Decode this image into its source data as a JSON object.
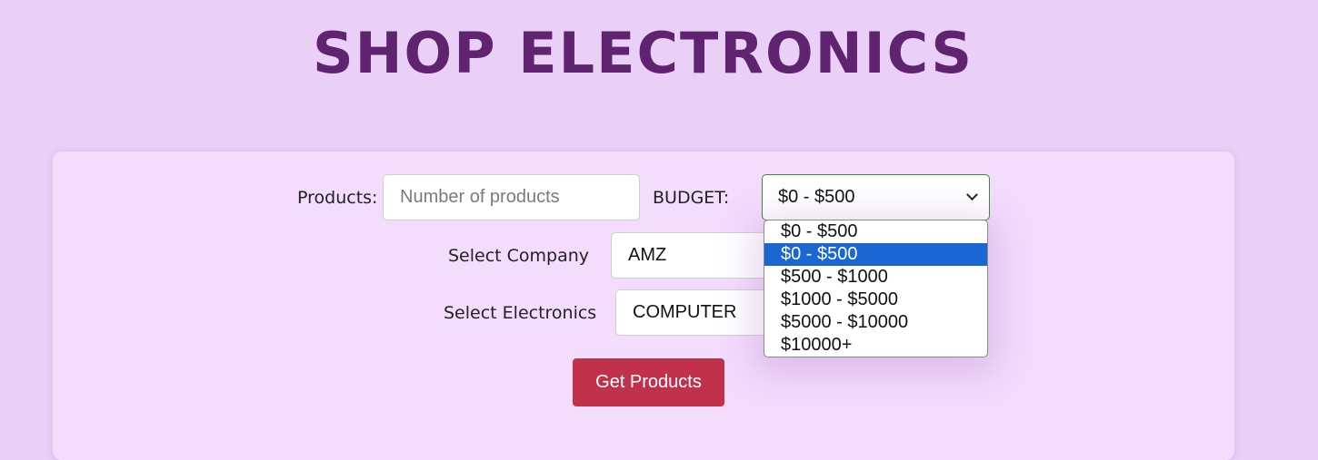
{
  "header": {
    "title": "SHOP ELECTRONICS"
  },
  "form": {
    "products_label": "Products:",
    "products_input": {
      "value": "",
      "placeholder": "Number of products"
    },
    "budget_label": "BUDGET:",
    "budget_select": {
      "selected": "$0 - $500"
    },
    "budget_options": [
      "$0 - $500",
      "$0 - $500",
      "$500 - $1000",
      "$1000 - $5000",
      "$5000 - $10000",
      "$10000+"
    ],
    "budget_highlighted_index": 1,
    "company_label": "Select Company",
    "company_select": {
      "selected": "AMZ"
    },
    "electronics_label": "Select Electronics",
    "electronics_select": {
      "selected": "COMPUTER"
    },
    "submit_label": "Get Products"
  },
  "colors": {
    "page_bg": "#eacff7",
    "panel_bg": "#f4dcfd",
    "title": "#5f2370",
    "button": "#c2314b",
    "highlight": "#1a66d2"
  }
}
